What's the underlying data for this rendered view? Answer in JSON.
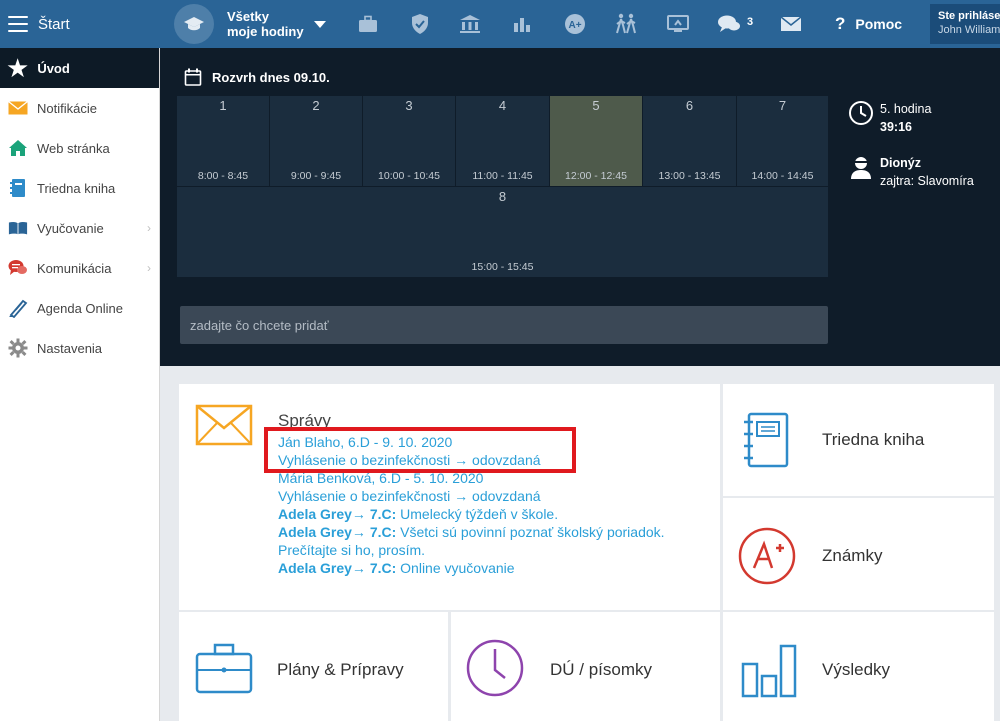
{
  "topbar": {
    "start_label": "Štart",
    "hours_line1": "Všetky",
    "hours_line2": "moje hodiny",
    "chat_badge": "3",
    "help_label": "Pomoc",
    "user_line1": "Ste prihlásený",
    "user_line2": "John Williams"
  },
  "sidebar": {
    "active_label": "Úvod",
    "items": [
      {
        "label": "Notifikácie"
      },
      {
        "label": "Web stránka"
      },
      {
        "label": "Triedna kniha"
      },
      {
        "label": "Vyučovanie"
      },
      {
        "label": "Komunikácia"
      },
      {
        "label": "Agenda Online"
      },
      {
        "label": "Nastavenia"
      }
    ]
  },
  "schedule": {
    "title": "Rozvrh dnes 09.10.",
    "lessons": [
      {
        "num": "1",
        "time": "8:00 - 8:45"
      },
      {
        "num": "2",
        "time": "9:00 - 9:45"
      },
      {
        "num": "3",
        "time": "10:00 - 10:45"
      },
      {
        "num": "4",
        "time": "11:00 - 11:45"
      },
      {
        "num": "5",
        "time": "12:00 - 12:45",
        "current": true
      },
      {
        "num": "6",
        "time": "13:00 - 13:45"
      },
      {
        "num": "7",
        "time": "14:00 - 14:45"
      },
      {
        "num": "8",
        "time": "15:00 - 15:45"
      }
    ],
    "current_lesson": "5. hodina",
    "countdown": "39:16",
    "nameday_name": "Dionýz",
    "nameday_tomorrow": "zajtra: Slavomíra",
    "add_placeholder": "zadajte čo chcete pridať"
  },
  "messages": {
    "title": "Správy",
    "items": [
      {
        "line1": "Ján Blaho, 6.D - 9. 10. 2020",
        "line2": "Vyhlásenie o bezinfekčnosti → odovzdaná"
      },
      {
        "line1": "Mária Benková, 6.D - 5. 10. 2020",
        "line2": "Vyhlásenie o bezinfekčnosti → odovzdaná"
      }
    ],
    "notices": [
      {
        "sender": "Adela Grey→ 7.C:",
        "text": " Umelecký týždeň v škole."
      },
      {
        "sender": "Adela Grey→ 7.C:",
        "text": " Všetci sú povinní poznať školský poriadok. Prečítajte si ho, prosím."
      },
      {
        "sender": "Adela Grey→ 7.C:",
        "text": " Online vyučovanie"
      }
    ]
  },
  "tiles": {
    "class_book": "Triedna kniha",
    "grades": "Známky",
    "plans": "Plány & Prípravy",
    "homework": "DÚ / písomky",
    "results": "Výsledky"
  },
  "colors": {
    "topbar": "#2a6496",
    "dark_panel": "#0f1c29",
    "link_blue": "#2a9fd8",
    "tile_icon_blue": "#2e8bc9",
    "highlight_red": "#e0191e",
    "current_lesson": "#4e5a4b"
  }
}
